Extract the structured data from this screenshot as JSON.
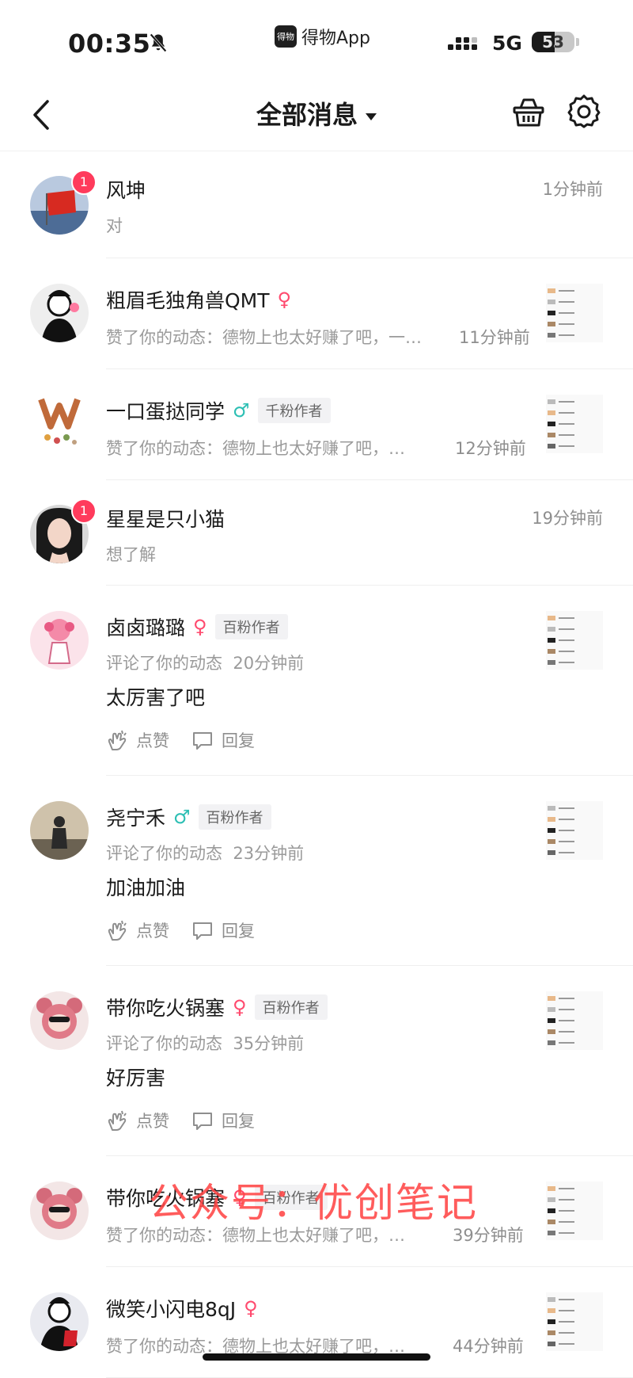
{
  "status_bar": {
    "time": "00:35",
    "app_logo": "得物",
    "app_name": "得物App",
    "network": "5G",
    "battery": "53",
    "battery_level": 0.53
  },
  "nav": {
    "title": "全部消息"
  },
  "colors": {
    "badge": "#ff3b5c",
    "female": "#ff4a6e",
    "male": "#2dbfb4",
    "watermark": "#ff4646"
  },
  "items": [
    {
      "type": "chat",
      "name": "风坤",
      "badge": "1",
      "preview": "对",
      "time": "1分钟前"
    },
    {
      "type": "like",
      "name": "粗眉毛独角兽QMT",
      "gender": "♀",
      "preview": "赞了你的动态：德物上也太好赚了吧，一…",
      "time": "11分钟前"
    },
    {
      "type": "like",
      "name": "一口蛋挞同学",
      "gender": "♂",
      "tag": "千粉作者",
      "preview": "赞了你的动态：德物上也太好赚了吧，…",
      "time": "12分钟前"
    },
    {
      "type": "chat",
      "name": "星星是只小猫",
      "badge": "1",
      "preview": "想了解",
      "time": "19分钟前"
    },
    {
      "type": "comment",
      "name": "卤卤璐璐",
      "gender": "♀",
      "tag": "百粉作者",
      "meta": "评论了你的动态",
      "time": "20分钟前",
      "comment": "太厉害了吧",
      "like_label": "点赞",
      "reply_label": "回复"
    },
    {
      "type": "comment",
      "name": "尧宁禾",
      "gender": "♂",
      "tag": "百粉作者",
      "meta": "评论了你的动态",
      "time": "23分钟前",
      "comment": "加油加油",
      "like_label": "点赞",
      "reply_label": "回复"
    },
    {
      "type": "comment",
      "name": "带你吃火锅塞",
      "gender": "♀",
      "tag": "百粉作者",
      "meta": "评论了你的动态",
      "time": "35分钟前",
      "comment": "好厉害",
      "like_label": "点赞",
      "reply_label": "回复"
    },
    {
      "type": "like",
      "name": "带你吃火锅塞",
      "gender": "♀",
      "tag": "百粉作者",
      "preview": "赞了你的动态：德物上也太好赚了吧，…",
      "time": "39分钟前"
    },
    {
      "type": "like",
      "name": "微笑小闪电8qJ",
      "gender": "♀",
      "preview": "赞了你的动态：德物上也太好赚了吧，…",
      "time": "44分钟前"
    }
  ],
  "watermark": "公众号：优创笔记"
}
